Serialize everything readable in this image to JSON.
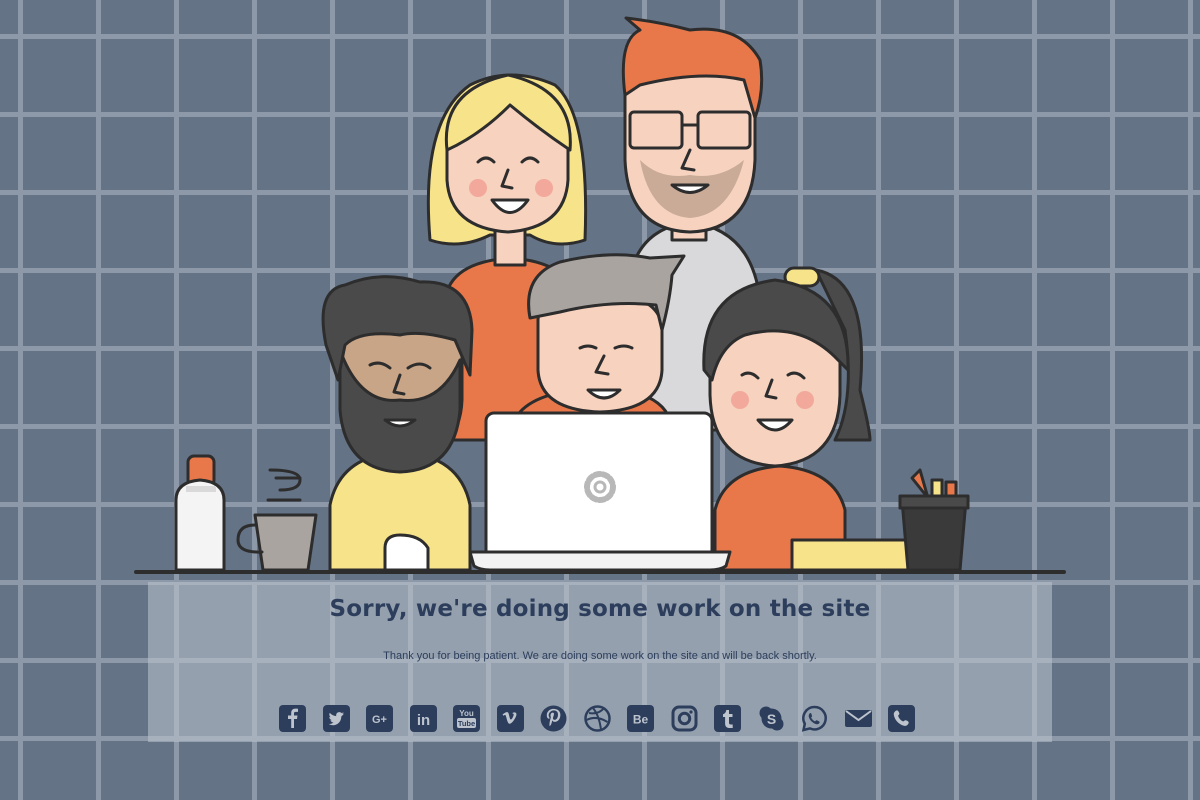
{
  "page": {
    "headline": "Sorry, we're doing some work on the site",
    "message": "Thank you for being patient. We are doing some work on the site and will be back shortly."
  },
  "colors": {
    "background": "#657387",
    "pattern": "#8d98a8",
    "panel": "#bec4ce",
    "text": "#2c3e5c",
    "icon": "#2c3e5c"
  },
  "social_icons": [
    {
      "name": "facebook-icon",
      "glyph": "f"
    },
    {
      "name": "twitter-icon",
      "glyph": "bird"
    },
    {
      "name": "google-plus-icon",
      "glyph": "G+"
    },
    {
      "name": "linkedin-icon",
      "glyph": "in"
    },
    {
      "name": "youtube-icon",
      "glyph": "You Tube"
    },
    {
      "name": "vimeo-icon",
      "glyph": "v"
    },
    {
      "name": "pinterest-icon",
      "glyph": "p"
    },
    {
      "name": "dribbble-icon",
      "glyph": "ball"
    },
    {
      "name": "behance-icon",
      "glyph": "Be"
    },
    {
      "name": "instagram-icon",
      "glyph": "camera"
    },
    {
      "name": "tumblr-icon",
      "glyph": "t"
    },
    {
      "name": "skype-icon",
      "glyph": "S"
    },
    {
      "name": "whatsapp-icon",
      "glyph": "phone-bubble"
    },
    {
      "name": "email-icon",
      "glyph": "envelope"
    },
    {
      "name": "phone-icon",
      "glyph": "phone"
    }
  ]
}
